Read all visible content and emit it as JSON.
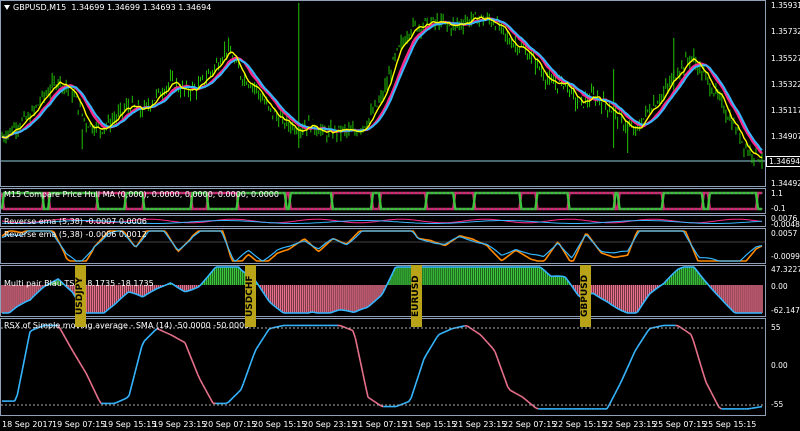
{
  "main": {
    "title": "GBPUSD,M15",
    "ohlc": "1.34699 1.34699 1.34693 1.34694",
    "current_price": "1.34694",
    "axis": [
      "1.35931",
      "1.35732",
      "1.35527",
      "1.35322",
      "1.35117",
      "1.34907",
      "1.34492"
    ]
  },
  "indicators": [
    {
      "title": "M15 Compare Price Hull MA (0,000), 0.0000, 0.0000, 0.0000, 0.0000",
      "axis": [
        "1.1",
        "-0.1"
      ]
    },
    {
      "title": "Reverse ema (5,38) -0.0007 0.0006",
      "axis": [
        "0.0076",
        "-0.0048"
      ]
    },
    {
      "title": "Reverse ema (5,38) -0.0006 0.0012",
      "axis": [
        "0.0057",
        "-0.0099"
      ]
    },
    {
      "title": "Multi pair Blau TSI -18.1735 -18.1735",
      "axis": [
        "47.3227",
        "0.00",
        "-62.1477"
      ]
    },
    {
      "title": "RSX of Simple moving average - SMA (14) -50.0000 -50.0000",
      "axis": [
        "55",
        "0.00",
        "-55"
      ]
    }
  ],
  "pairs": [
    "USDJPY",
    "USDCHF",
    "EURUSD",
    "GBPUSD"
  ],
  "time_axis": [
    "18 Sep 2017",
    "19 Sep 07:15",
    "19 Sep 15:15",
    "19 Sep 23:15",
    "20 Sep 07:15",
    "20 Sep 15:15",
    "20 Sep 23:15",
    "21 Sep 07:15",
    "21 Sep 15:15",
    "21 Sep 23:15",
    "22 Sep 07:15",
    "22 Sep 15:15",
    "22 Sep 23:15",
    "25 Sep 07:15",
    "25 Sep 15:15"
  ],
  "colors": {
    "bull_candle": "#22c000",
    "ma_fast": "#ffff00",
    "ma_slow": "#ff2a8a",
    "ma_blue": "#36b6ff",
    "panel_border": "#8fa0b8",
    "osc_orange": "#ff8a00",
    "hist_pink": "#e8708a",
    "hist_green": "#3cc63c"
  },
  "series": {
    "main_price": [
      1.3487,
      1.3496,
      1.3503,
      1.352,
      1.3533,
      1.3522,
      1.3498,
      1.3493,
      1.3501,
      1.3512,
      1.3507,
      1.352,
      1.3531,
      1.3523,
      1.3527,
      1.3541,
      1.3558,
      1.3536,
      1.3527,
      1.3508,
      1.3499,
      1.3494,
      1.3497,
      1.3489,
      1.3492,
      1.349,
      1.35,
      1.3518,
      1.3552,
      1.3574,
      1.3577,
      1.3578,
      1.3575,
      1.358,
      1.3582,
      1.3579,
      1.3564,
      1.3558,
      1.3545,
      1.3529,
      1.353,
      1.3512,
      1.352,
      1.3512,
      1.35,
      1.349,
      1.351,
      1.3521,
      1.354,
      1.3551,
      1.3534,
      1.3516,
      1.3496,
      1.3476,
      1.347
    ],
    "rsx": [
      -45,
      -45,
      45,
      52,
      52,
      20,
      -10,
      -48,
      -48,
      -40,
      30,
      48,
      40,
      30,
      -15,
      -48,
      -48,
      -30,
      20,
      48,
      52,
      52,
      52,
      52,
      52,
      45,
      -40,
      -52,
      -52,
      -45,
      10,
      40,
      48,
      52,
      40,
      20,
      -30,
      -40,
      -55,
      -55,
      -55,
      -55,
      -55,
      -55,
      -20,
      20,
      48,
      52,
      52,
      40,
      -20,
      -55,
      -55,
      -55,
      -52
    ]
  }
}
